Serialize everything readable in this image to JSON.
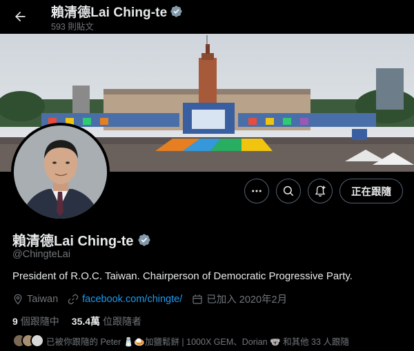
{
  "header": {
    "name": "賴清德Lai Ching-te",
    "post_count": "593 則貼文"
  },
  "profile": {
    "display_name": "賴清德Lai Ching-te",
    "handle": "@ChingteLai",
    "bio": "President of R.O.C. Taiwan. Chairperson of Democratic Progressive Party.",
    "location": "Taiwan",
    "website": "facebook.com/chingte/",
    "joined": "已加入 2020年2月",
    "following_count": "9",
    "following_label": "個跟隨中",
    "followers_count": "35.4萬",
    "followers_label": "位跟隨者",
    "followed_by_text": "已被你跟隨的 Peter 🧂🍛加鹽鬆餅 | 1000X GEM、Dorian 🐨 和其他 33 人跟隨"
  },
  "actions": {
    "more_icon": "more-dots-icon",
    "search_icon": "search-icon",
    "notify_icon": "bell-plus-icon",
    "follow_label": "正在跟隨"
  },
  "colors": {
    "background": "#000000",
    "accent": "#1d9bf0",
    "text": "#e7e9ea",
    "muted": "#71767b",
    "border": "#536471"
  }
}
